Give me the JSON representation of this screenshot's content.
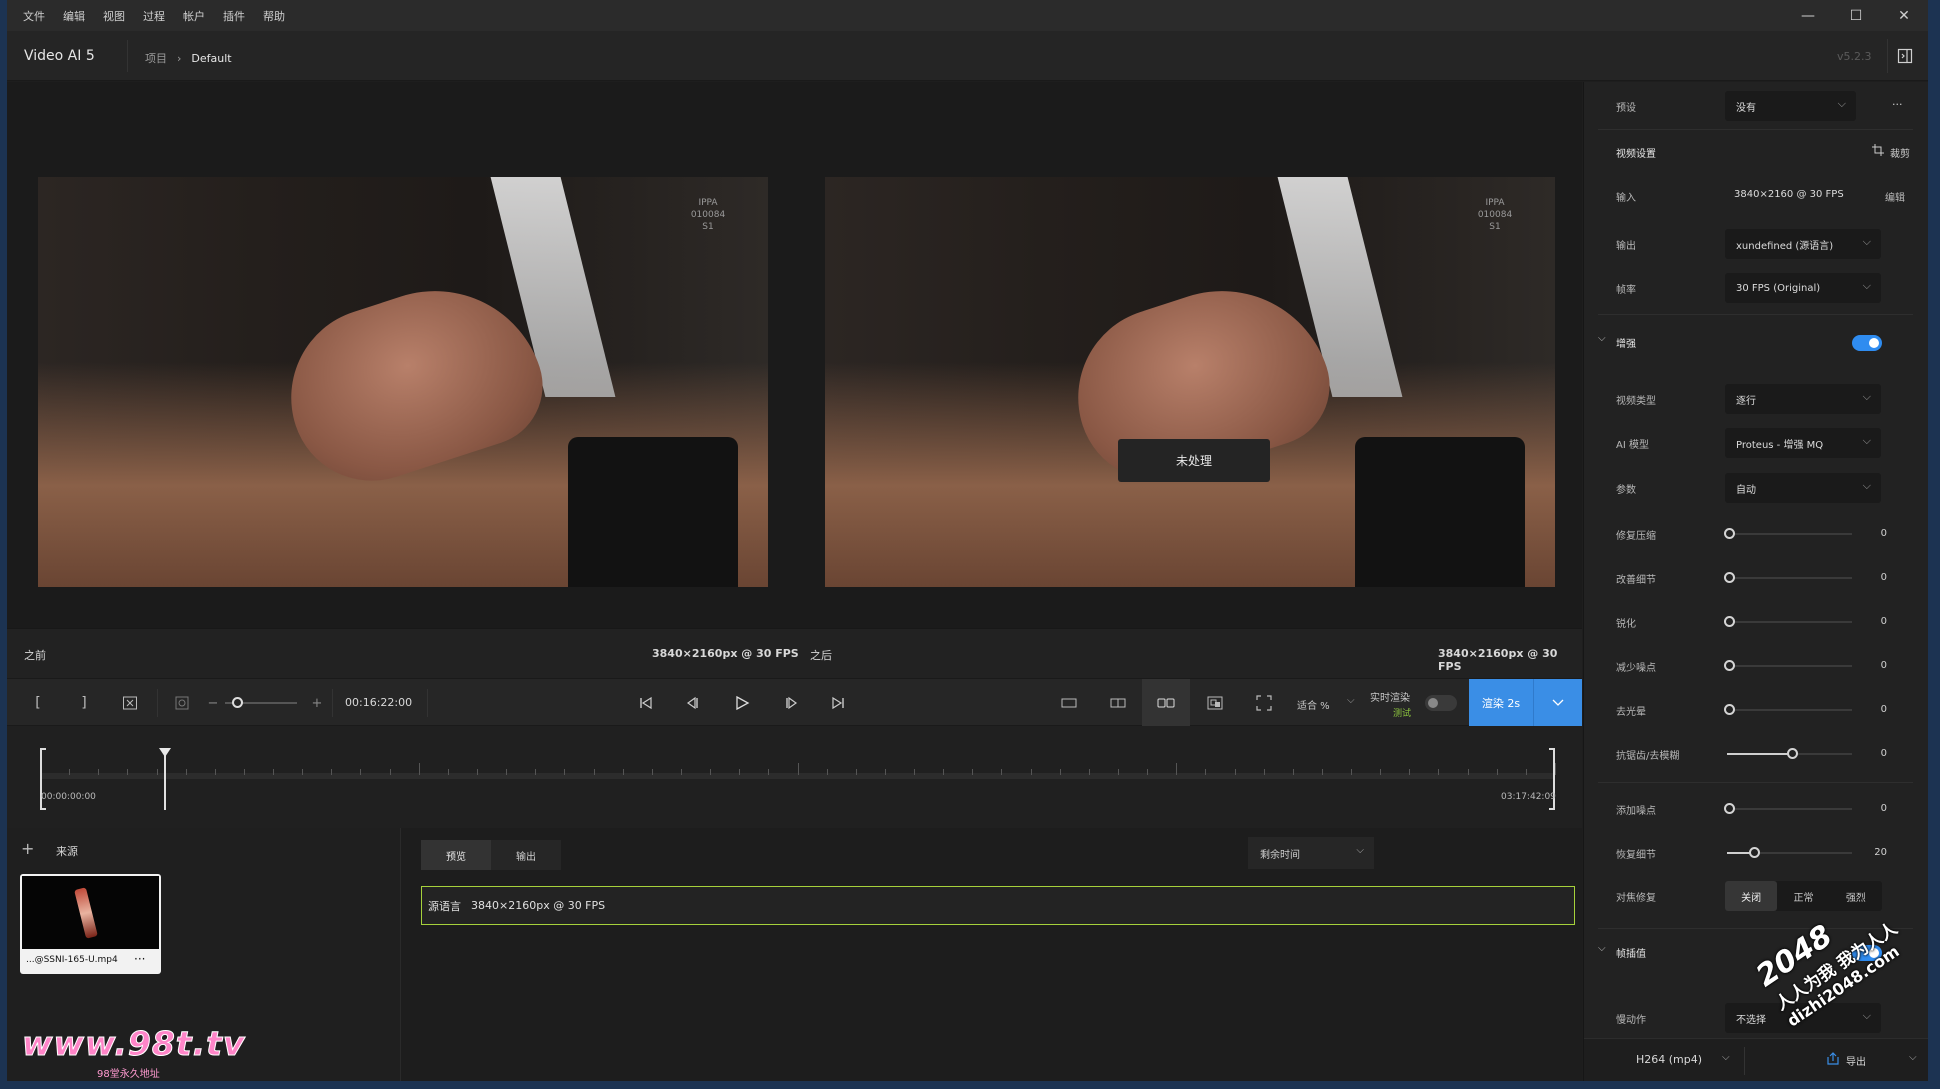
{
  "menu": [
    "文件",
    "编辑",
    "视图",
    "过程",
    "帐户",
    "插件",
    "帮助"
  ],
  "window_controls": {
    "minimize": "—",
    "maximize": "☐",
    "close": "✕"
  },
  "header": {
    "app_name": "Video AI  5",
    "breadcrumb_root": "项目",
    "breadcrumb_sep": "›",
    "breadcrumb_current": "Default",
    "version": "v5.2.3"
  },
  "preview": {
    "overlay_label": "未处理",
    "left_logo": "IPPA\n010084\nS1",
    "right_logo": "IPPA\n010084\nS1"
  },
  "info": {
    "before_label": "之前",
    "before_res": "3840×2160px @ 30 FPS",
    "after_label": "之后",
    "after_res": "3840×2160px @ 30 FPS"
  },
  "toolbar": {
    "timecode": "00:16:22:00",
    "fit_label": "适合 %",
    "realtime_label": "实时渲染",
    "realtime_badge": "测试",
    "render_label": "渲染 2s",
    "zoom_minus": "−",
    "zoom_plus": "+",
    "mark_in": "[",
    "mark_out": "]"
  },
  "timeline": {
    "start": "00:00:00:00",
    "end": "03:17:42:09",
    "playhead_fraction": 0.082
  },
  "sources": {
    "title": "来源",
    "add": "+",
    "file_name": "...@SSNI-165-U.mp4",
    "more": "···"
  },
  "export_queue": {
    "tabs": [
      "预览",
      "输出"
    ],
    "active_tab": 0,
    "sort": "剩余时间",
    "item_source": "源语言",
    "item_res": "3840×2160px @ 30 FPS"
  },
  "sidebar": {
    "preset_label": "预设",
    "preset_value": "没有",
    "preset_more": "···",
    "video_settings_title": "视频设置",
    "crop_label": "裁剪",
    "input_label": "输入",
    "input_value": "3840×2160 @ 30 FPS",
    "input_edit": "编辑",
    "output_label": "输出",
    "output_value": "xundefined (源语言)",
    "fps_label": "帧率",
    "fps_value": "30 FPS (Original)",
    "enhance_title": "增强",
    "enhance_on": true,
    "video_type_label": "视频类型",
    "video_type_value": "逐行",
    "ai_model_label": "AI 模型",
    "ai_model_value": "Proteus - 增强 MQ",
    "params_label": "参数",
    "params_value": "自动",
    "sliders": [
      {
        "label": "修复压缩",
        "value": "0",
        "fraction": 0.0
      },
      {
        "label": "改善细节",
        "value": "0",
        "fraction": 0.0
      },
      {
        "label": "锐化",
        "value": "0",
        "fraction": 0.0
      },
      {
        "label": "减少噪点",
        "value": "0",
        "fraction": 0.0
      },
      {
        "label": "去光晕",
        "value": "0",
        "fraction": 0.0
      },
      {
        "label": "抗锯齿/去模糊",
        "value": "0",
        "fraction": 0.5
      }
    ],
    "sliders2": [
      {
        "label": "添加噪点",
        "value": "0",
        "fraction": 0.0
      },
      {
        "label": "恢复细节",
        "value": "20",
        "fraction": 0.2
      }
    ],
    "focus_label": "对焦修复",
    "focus_options": [
      "关闭",
      "正常",
      "强烈"
    ],
    "focus_selected": 0,
    "interp_title": "帧插值",
    "interp_on": true,
    "slowmo_label": "慢动作",
    "slowmo_value": "不选择",
    "codec_value": "H264 (mp4)",
    "export_label": "导出"
  },
  "watermarks": {
    "site": "www.98t.tv",
    "site_sub": "98堂永久地址",
    "stamp_top": "2048",
    "stamp_mid": "人人为我 我为人人",
    "stamp_bot": "dizhi2048.com"
  },
  "colors": {
    "accent": "#3a8ee6",
    "highlight_border": "#a6d13b",
    "beta_green": "#8dc63f"
  }
}
